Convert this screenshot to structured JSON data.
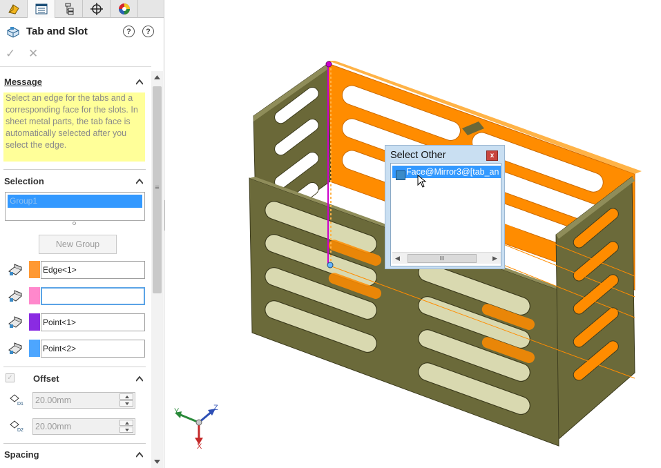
{
  "panel": {
    "tabs": [
      {
        "icon": "feature-manager-icon"
      },
      {
        "icon": "property-manager-icon"
      },
      {
        "icon": "configuration-manager-icon"
      },
      {
        "icon": "dimxpert-manager-icon"
      },
      {
        "icon": "display-manager-icon"
      }
    ],
    "title": "Tab and Slot",
    "help_icon": "help-icon",
    "help2_icon": "help-circle-icon",
    "message": {
      "heading": "Message",
      "text": "Select an edge for the tabs and a corresponding face for the slots. In sheet metal parts, the tab face is automatically selected after you select the edge."
    },
    "selection": {
      "heading": "Selection",
      "group": "Group1",
      "new_group_label": "New Group",
      "fields": [
        {
          "value": "Edge<1>",
          "color": "#ff9933"
        },
        {
          "value": "",
          "color": "#ff88cc"
        },
        {
          "value": "Point<1>",
          "color": "#8a2be2"
        },
        {
          "value": "Point<2>",
          "color": "#4da6ff"
        }
      ]
    },
    "offset": {
      "heading": "Offset",
      "d1": "20.00mm",
      "d2": "20.00mm"
    },
    "spacing": {
      "heading": "Spacing"
    }
  },
  "dialog": {
    "title": "Select Other",
    "close_label": "x",
    "item": "Face@Mirror3@[tab_an",
    "scroll_thumb": "III"
  },
  "triad": {
    "y": "Y",
    "z": "Z",
    "x": "X"
  },
  "colors": {
    "accent": "#3399ff",
    "selection_orange": "#ff8c00",
    "model": "#6b6a3a"
  }
}
